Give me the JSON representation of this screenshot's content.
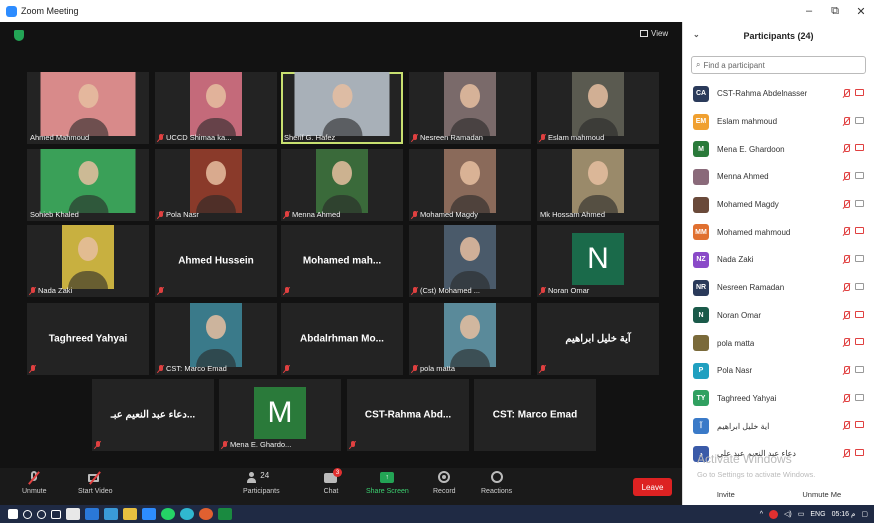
{
  "window": {
    "title": "Zoom Meeting",
    "controls": [
      "–",
      "⧉",
      "✕"
    ]
  },
  "stage": {
    "view_label": "View"
  },
  "tiles": [
    {
      "name": "Ahmed Mahmoud",
      "muted": false,
      "kind": "photo",
      "bg": "#d88a8a"
    },
    {
      "name": "UCCD Shimaa ka...",
      "muted": true,
      "kind": "photo",
      "bg": "#c46a7a"
    },
    {
      "name": "Sherif G. Hafez",
      "muted": false,
      "kind": "photo",
      "bg": "#a8b0b8",
      "active": true
    },
    {
      "name": "Nesreen Ramadan",
      "muted": true,
      "kind": "photo",
      "bg": "#7a6a6a"
    },
    {
      "name": "Eslam mahmoud",
      "muted": true,
      "kind": "photo",
      "bg": "#5a5a50"
    },
    {
      "name": "Sohieb Khaled",
      "muted": false,
      "kind": "photo",
      "bg": "#3aa058"
    },
    {
      "name": "Pola Nasr",
      "muted": true,
      "kind": "photo",
      "bg": "#8a3a2a"
    },
    {
      "name": "Menna Ahmed",
      "muted": true,
      "kind": "photo",
      "bg": "#3a6a3a"
    },
    {
      "name": "Mohamed Magdy",
      "muted": true,
      "kind": "photo",
      "bg": "#8a6a5a"
    },
    {
      "name": "Mk Hossam Ahmed",
      "muted": false,
      "kind": "photo",
      "bg": "#9a8a6a"
    },
    {
      "name": "Nada Zaki",
      "muted": true,
      "kind": "photo",
      "bg": "#c8b040"
    },
    {
      "name": "",
      "muted": true,
      "kind": "text",
      "big": "Ahmed Hussein"
    },
    {
      "name": "",
      "muted": true,
      "kind": "text",
      "big": "Mohamed mah..."
    },
    {
      "name": "(Cst) Mohamed ...",
      "muted": true,
      "kind": "photo",
      "bg": "#4a5a6a"
    },
    {
      "name": "Noran Omar",
      "muted": true,
      "kind": "letter",
      "letter": "N",
      "bg": "#1a6a4a"
    },
    {
      "name": "",
      "muted": true,
      "kind": "text",
      "big": "Taghreed Yahyai"
    },
    {
      "name": "CST: Marco Emad",
      "muted": true,
      "kind": "photo",
      "bg": "#3a7a8a"
    },
    {
      "name": "",
      "muted": true,
      "kind": "text",
      "big": "Abdalrhman Mo..."
    },
    {
      "name": "pola matta",
      "muted": true,
      "kind": "photo",
      "bg": "#5a8a9a"
    },
    {
      "name": "",
      "muted": true,
      "kind": "text",
      "big": "آية خليل ابراهيم"
    },
    {
      "name": "",
      "muted": true,
      "kind": "text",
      "big": "دعاء عبد النعيم عبـ..."
    },
    {
      "name": "Mena E. Ghardo...",
      "muted": true,
      "kind": "letter",
      "letter": "M",
      "bg": "#2a7a3a"
    },
    {
      "name": "",
      "muted": true,
      "kind": "text",
      "big": "CST-Rahma Abd..."
    },
    {
      "name": "",
      "muted": false,
      "kind": "text",
      "big": "CST: Marco Emad"
    }
  ],
  "toolbar": {
    "unmute": "Unmute",
    "start_video": "Start Video",
    "participants": "Participants",
    "participants_count": "24",
    "chat": "Chat",
    "chat_badge": "3",
    "share_screen": "Share Screen",
    "record": "Record",
    "reactions": "Reactions",
    "leave": "Leave"
  },
  "panel": {
    "title": "Participants (24)",
    "search_placeholder": "Find a participant",
    "participants": [
      {
        "initials": "CA",
        "name": "CST-Rahma Abdelnasser",
        "color": "#2a3a5a",
        "video_off": false
      },
      {
        "initials": "EM",
        "name": "Eslam mahmoud",
        "color": "#f0a030",
        "video_off": true
      },
      {
        "initials": "M",
        "name": "Mena E. Ghardoon",
        "color": "#2a7a3a",
        "video_off": false
      },
      {
        "initials": "",
        "name": "Menna Ahmed",
        "color": "#8a6a7a",
        "video_off": true
      },
      {
        "initials": "",
        "name": "Mohamed Magdy",
        "color": "#6a4a3a",
        "video_off": true
      },
      {
        "initials": "MM",
        "name": "Mohamed mahmoud",
        "color": "#e07030",
        "video_off": false
      },
      {
        "initials": "NZ",
        "name": "Nada Zaki",
        "color": "#8a4ac8",
        "video_off": true
      },
      {
        "initials": "NR",
        "name": "Nesreen Ramadan",
        "color": "#2a3a5a",
        "video_off": true
      },
      {
        "initials": "N",
        "name": "Noran Omar",
        "color": "#1a5a4a",
        "video_off": false
      },
      {
        "initials": "",
        "name": "pola matta",
        "color": "#7a6a3a",
        "video_off": false
      },
      {
        "initials": "P",
        "name": "Pola Nasr",
        "color": "#20a0c0",
        "video_off": true
      },
      {
        "initials": "TY",
        "name": "Taghreed Yahyai",
        "color": "#30a060",
        "video_off": true
      },
      {
        "initials": "آ",
        "name": "آية خليل ابراهيم",
        "color": "#3a7ac8",
        "video_off": false
      },
      {
        "initials": "د",
        "name": "دعاء عبد النعيم عبد علي",
        "color": "#3a5aa8",
        "video_off": false
      }
    ],
    "watermark_title": "Activate Windows",
    "watermark_sub": "Go to Settings to activate Windows.",
    "invite": "Invite",
    "unmute_me": "Unmute Me"
  },
  "taskbar": {
    "tray_lang": "ENG",
    "clock": "05:16 م"
  }
}
